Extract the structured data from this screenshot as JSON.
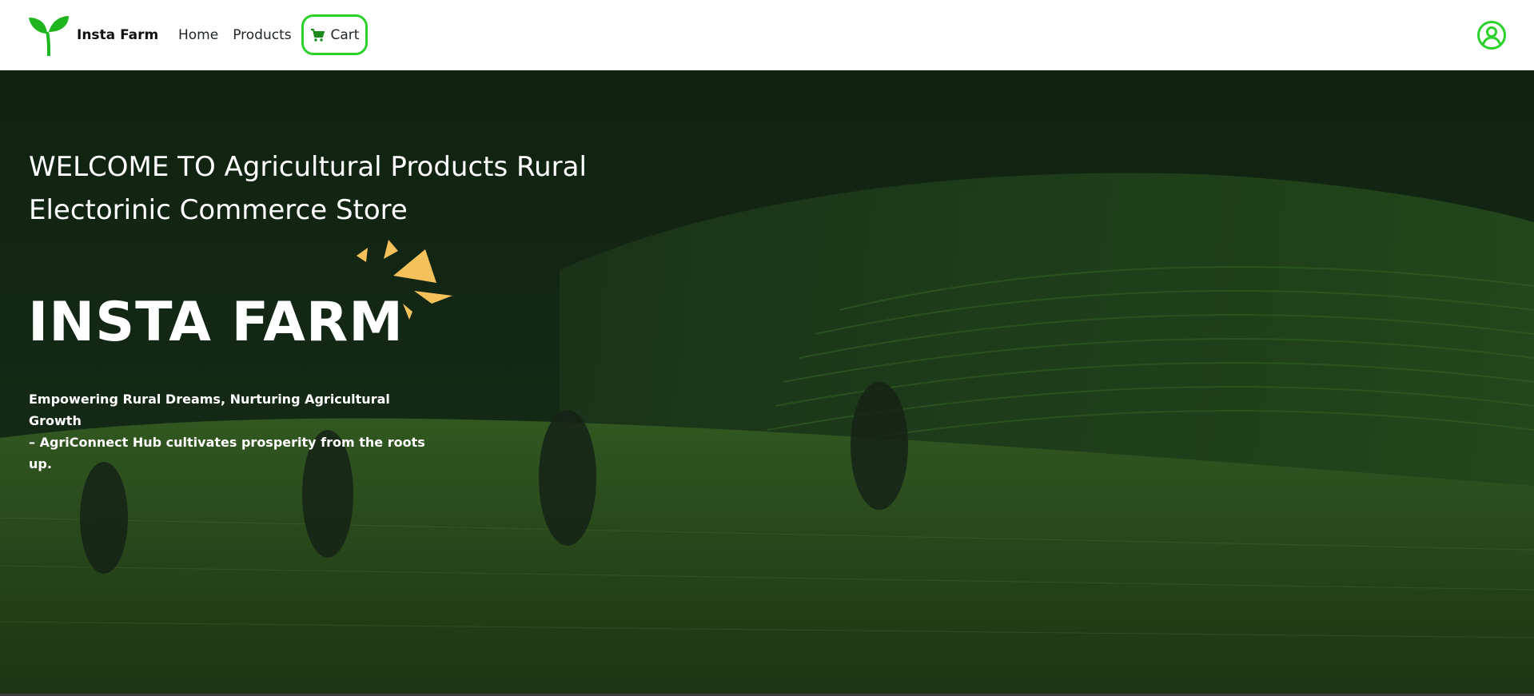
{
  "brand": {
    "name": "Insta Farm",
    "logo_icon": "sprout-icon",
    "logo_color": "#1fb51f"
  },
  "nav": {
    "items": [
      {
        "label": "Home"
      },
      {
        "label": "Products"
      }
    ],
    "cart": {
      "label": "Cart",
      "icon": "cart-icon",
      "border_color": "#2bd12b"
    },
    "profile": {
      "icon": "user-circle-icon",
      "color": "#2bd12b"
    }
  },
  "hero": {
    "welcome": "WELCOME TO Agricultural Products Rural Electorinic Commerce Store",
    "title": "INSTA FARM",
    "tagline_line1": "Empowering Rural Dreams, Nurturing Agricultural Growth",
    "tagline_line2": "– AgriConnect Hub cultivates prosperity from the roots up.",
    "accent_color": "#f5c15a"
  }
}
